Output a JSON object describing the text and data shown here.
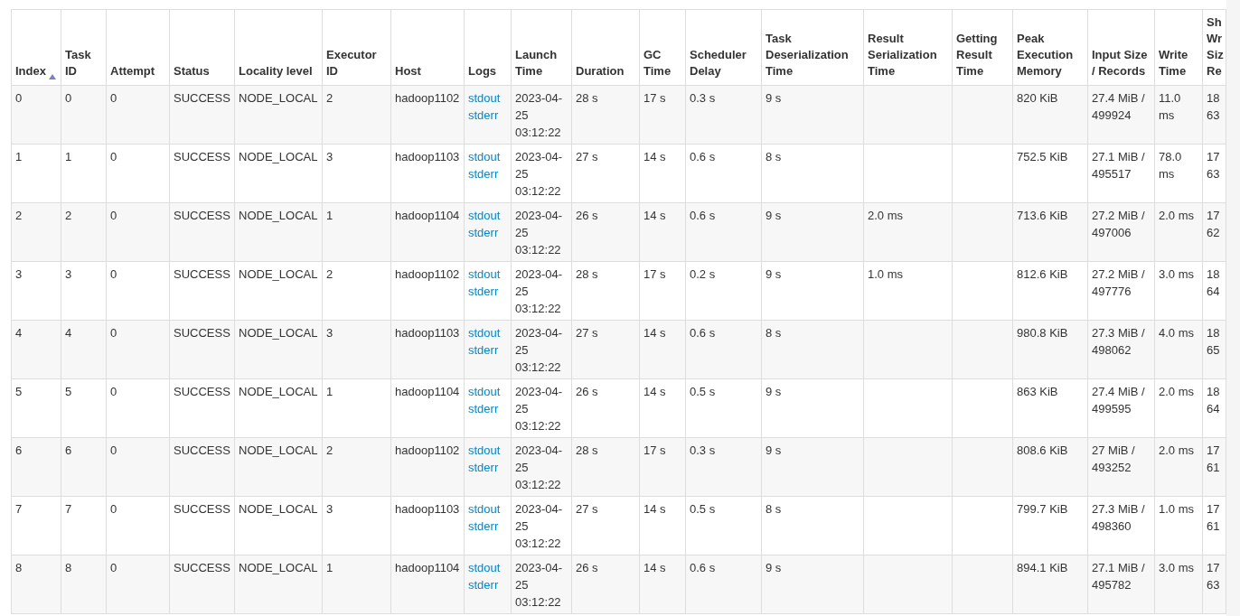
{
  "table": {
    "columns": [
      {
        "label": "Index",
        "sorted": true
      },
      {
        "label": "Task ID"
      },
      {
        "label": "Attempt"
      },
      {
        "label": "Status"
      },
      {
        "label": "Locality level"
      },
      {
        "label": "Executor ID"
      },
      {
        "label": "Host"
      },
      {
        "label": "Logs"
      },
      {
        "label": "Launch Time"
      },
      {
        "label": "Duration"
      },
      {
        "label": "GC Time"
      },
      {
        "label": "Scheduler Delay"
      },
      {
        "label": "Task Deserialization Time"
      },
      {
        "label": "Result Serialization Time"
      },
      {
        "label": "Getting Result Time"
      },
      {
        "label": "Peak Execution Memory"
      },
      {
        "label": "Input Size / Records"
      },
      {
        "label": "Write Time"
      },
      {
        "label": "Sh Wr Siz Re"
      }
    ],
    "rows": [
      {
        "index": "0",
        "task_id": "0",
        "attempt": "0",
        "status": "SUCCESS",
        "locality": "NODE_LOCAL",
        "executor": "2",
        "host": "hadoop1102",
        "logs": [
          "stdout",
          "stderr"
        ],
        "launch": "2023-04-25 03:12:22",
        "duration": "28 s",
        "gc": "17 s",
        "scheduler_delay": "0.3 s",
        "deserialization": "9 s",
        "peak_memory": "820 KiB",
        "input": "27.4 MiB / 499924",
        "write_time": "11.0 ms",
        "column_19": "18 63"
      },
      {
        "index": "1",
        "task_id": "1",
        "attempt": "0",
        "status": "SUCCESS",
        "locality": "NODE_LOCAL",
        "executor": "3",
        "host": "hadoop1103",
        "logs": [
          "stdout",
          "stderr"
        ],
        "launch": "2023-04-25 03:12:22",
        "duration": "27 s",
        "gc": "14 s",
        "scheduler_delay": "0.6 s",
        "deserialization": "8 s",
        "peak_memory": "752.5 KiB",
        "input": "27.1 MiB / 495517",
        "write_time": "78.0 ms",
        "column_19": "17 63"
      },
      {
        "index": "2",
        "task_id": "2",
        "attempt": "0",
        "status": "SUCCESS",
        "locality": "NODE_LOCAL",
        "executor": "1",
        "host": "hadoop1104",
        "logs": [
          "stdout",
          "stderr"
        ],
        "launch": "2023-04-25 03:12:22",
        "duration": "26 s",
        "gc": "14 s",
        "scheduler_delay": "0.6 s",
        "deserialization": "9 s",
        "result_serialization": "2.0 ms",
        "peak_memory": "713.6 KiB",
        "input": "27.2 MiB / 497006",
        "write_time": "2.0 ms",
        "column_19": "17 62"
      },
      {
        "index": "3",
        "task_id": "3",
        "attempt": "0",
        "status": "SUCCESS",
        "locality": "NODE_LOCAL",
        "executor": "2",
        "host": "hadoop1102",
        "logs": [
          "stdout",
          "stderr"
        ],
        "launch": "2023-04-25 03:12:22",
        "duration": "28 s",
        "gc": "17 s",
        "scheduler_delay": "0.2 s",
        "deserialization": "9 s",
        "result_serialization": "1.0 ms",
        "peak_memory": "812.6 KiB",
        "input": "27.2 MiB / 497776",
        "write_time": "3.0 ms",
        "column_19": "18 64"
      },
      {
        "index": "4",
        "task_id": "4",
        "attempt": "0",
        "status": "SUCCESS",
        "locality": "NODE_LOCAL",
        "executor": "3",
        "host": "hadoop1103",
        "logs": [
          "stdout",
          "stderr"
        ],
        "launch": "2023-04-25 03:12:22",
        "duration": "27 s",
        "gc": "14 s",
        "scheduler_delay": "0.6 s",
        "deserialization": "8 s",
        "peak_memory": "980.8 KiB",
        "input": "27.3 MiB / 498062",
        "write_time": "4.0 ms",
        "column_19": "18 65"
      },
      {
        "index": "5",
        "task_id": "5",
        "attempt": "0",
        "status": "SUCCESS",
        "locality": "NODE_LOCAL",
        "executor": "1",
        "host": "hadoop1104",
        "logs": [
          "stdout",
          "stderr"
        ],
        "launch": "2023-04-25 03:12:22",
        "duration": "26 s",
        "gc": "14 s",
        "scheduler_delay": "0.5 s",
        "deserialization": "9 s",
        "peak_memory": "863 KiB",
        "input": "27.4 MiB / 499595",
        "write_time": "2.0 ms",
        "column_19": "18 64"
      },
      {
        "index": "6",
        "task_id": "6",
        "attempt": "0",
        "status": "SUCCESS",
        "locality": "NODE_LOCAL",
        "executor": "2",
        "host": "hadoop1102",
        "logs": [
          "stdout",
          "stderr"
        ],
        "launch": "2023-04-25 03:12:22",
        "duration": "28 s",
        "gc": "17 s",
        "scheduler_delay": "0.3 s",
        "deserialization": "9 s",
        "peak_memory": "808.6 KiB",
        "input": "27 MiB / 493252",
        "write_time": "2.0 ms",
        "column_19": "17 61"
      },
      {
        "index": "7",
        "task_id": "7",
        "attempt": "0",
        "status": "SUCCESS",
        "locality": "NODE_LOCAL",
        "executor": "3",
        "host": "hadoop1103",
        "logs": [
          "stdout",
          "stderr"
        ],
        "launch": "2023-04-25 03:12:22",
        "duration": "27 s",
        "gc": "14 s",
        "scheduler_delay": "0.5 s",
        "deserialization": "8 s",
        "peak_memory": "799.7 KiB",
        "input": "27.3 MiB / 498360",
        "write_time": "1.0 ms",
        "column_19": "17 61"
      },
      {
        "index": "8",
        "task_id": "8",
        "attempt": "0",
        "status": "SUCCESS",
        "locality": "NODE_LOCAL",
        "executor": "1",
        "host": "hadoop1104",
        "logs": [
          "stdout",
          "stderr"
        ],
        "launch": "2023-04-25 03:12:22",
        "duration": "26 s",
        "gc": "14 s",
        "scheduler_delay": "0.6 s",
        "deserialization": "9 s",
        "peak_memory": "894.1 KiB",
        "input": "27.1 MiB / 495782",
        "write_time": "3.0 ms",
        "column_19": "17 63"
      }
    ]
  }
}
